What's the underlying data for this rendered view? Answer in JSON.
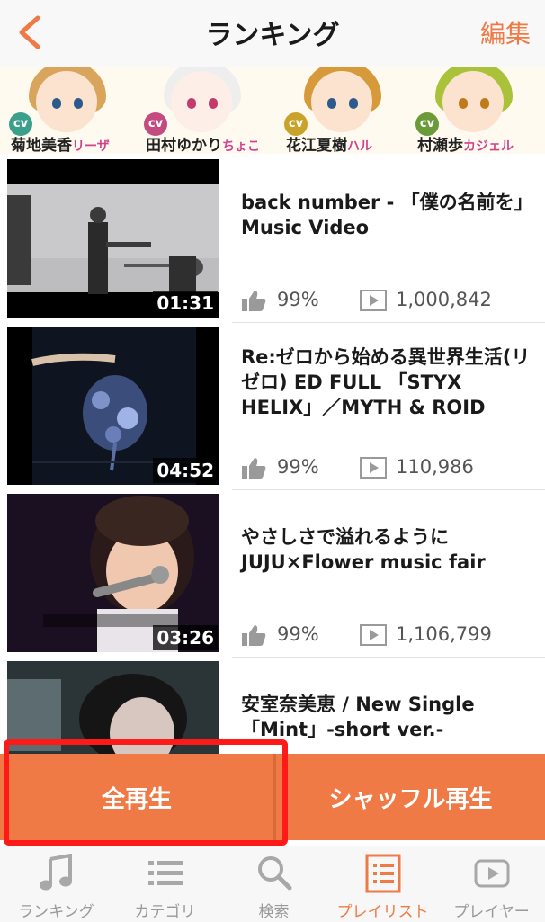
{
  "header": {
    "title": "ランキング",
    "edit_label": "編集"
  },
  "banner": {
    "cast": [
      {
        "cv": "cv",
        "name": "菊地美香",
        "chara": "リーザ",
        "color": "#3aa08c"
      },
      {
        "cv": "cv",
        "name": "田村ゆかり",
        "chara": "ちょこ",
        "color": "#c44b7f"
      },
      {
        "cv": "cv",
        "name": "花江夏樹",
        "chara": "ハル",
        "color": "#c9a229"
      },
      {
        "cv": "cv",
        "name": "村瀬歩",
        "chara": "カジェル",
        "color": "#6a9a3a"
      }
    ]
  },
  "videos": [
    {
      "title": "back number - 「僕の名前を」Music Video",
      "duration": "01:31",
      "like_pct": "99%",
      "views": "1,000,842"
    },
    {
      "title": "Re:ゼロから始める異世界生活(リゼロ) ED FULL 「STYX HELIX」／MYTH & ROID",
      "duration": "04:52",
      "like_pct": "99%",
      "views": "110,986"
    },
    {
      "title": "やさしさで溢れるように JUJU×Flower music fair",
      "duration": "03:26",
      "like_pct": "99%",
      "views": "1,106,799"
    },
    {
      "title": "安室奈美恵 / New Single「Mint」-short ver.-",
      "duration": "",
      "like_pct": "",
      "views": ""
    }
  ],
  "actions": {
    "play_all": "全再生",
    "shuffle": "シャッフル再生"
  },
  "tabs": [
    {
      "label": "ランキング",
      "icon": "music-note-icon"
    },
    {
      "label": "カテゴリ",
      "icon": "list-icon"
    },
    {
      "label": "検索",
      "icon": "search-icon"
    },
    {
      "label": "プレイリスト",
      "icon": "playlist-icon"
    },
    {
      "label": "プレイヤー",
      "icon": "player-icon"
    }
  ],
  "colors": {
    "accent": "#ef7a45",
    "highlight": "#ff1a1a"
  }
}
